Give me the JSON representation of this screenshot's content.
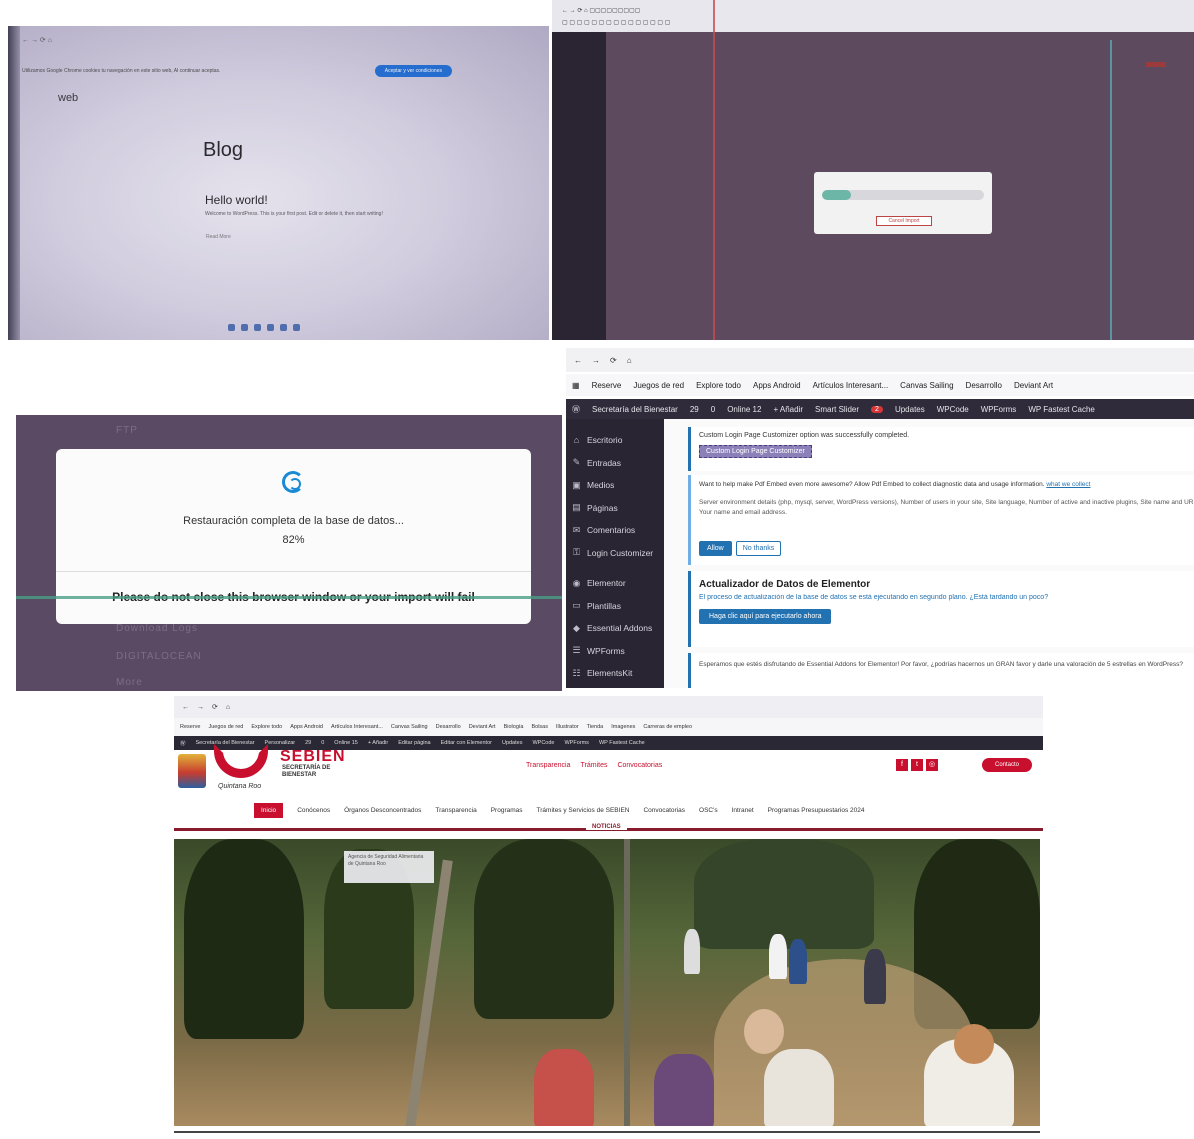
{
  "panel1": {
    "cookie_text": "Utilizamos Google Chrome cookies tu navegación en este sitio web, Al continuar aceptas.",
    "cookie_button": "Aceptar y ver condiciones",
    "site_name": "web",
    "blog_title": "Blog",
    "post_title": "Hello world!",
    "post_excerpt": "Welcome to WordPress. This is your first post. Edit or delete it, then start writing!",
    "post_link": "Read More"
  },
  "panel2": {
    "progress_fraction": 0.18,
    "modal_button": "Cancel Import"
  },
  "panel3": {
    "modal_title": "Restauración completa de la base de datos...",
    "modal_percent": "82%",
    "modal_warning": "Please do not close this browser window or your import will fail",
    "background_rows": [
      "FTP",
      "Download Logs",
      "DIGITALOCEAN",
      "More"
    ]
  },
  "panel4": {
    "bookmarks": [
      "Reserve",
      "Juegos de red",
      "Explore todo",
      "Apps Android",
      "Artículos Interesant...",
      "Canvas Sailing",
      "Desarrollo",
      "Deviant Art"
    ],
    "adminbar": [
      "Secretaría del Bienestar",
      "29",
      "0",
      "Online 12",
      "+ Añadir",
      "Smart Slider",
      "Updates",
      "WPCode",
      "WPForms",
      "WP Fastest Cache"
    ],
    "adminbar_badge": "2",
    "sidebar": [
      {
        "label": "Escritorio",
        "icon": "dashboard-icon",
        "glyph": "⌂"
      },
      {
        "label": "Entradas",
        "icon": "pin-icon",
        "glyph": "✎"
      },
      {
        "label": "Medios",
        "icon": "media-icon",
        "glyph": "▣"
      },
      {
        "label": "Páginas",
        "icon": "pages-icon",
        "glyph": "▤"
      },
      {
        "label": "Comentarios",
        "icon": "comment-icon",
        "glyph": "✉"
      },
      {
        "label": "Login Customizer",
        "icon": "lock-icon",
        "glyph": "⚿"
      },
      {
        "label": "Elementor",
        "icon": "elementor-icon",
        "glyph": "◉"
      },
      {
        "label": "Plantillas",
        "icon": "folder-icon",
        "glyph": "▭"
      },
      {
        "label": "Essential Addons",
        "icon": "addons-icon",
        "glyph": "◆"
      },
      {
        "label": "WPForms",
        "icon": "forms-icon",
        "glyph": "☰"
      },
      {
        "label": "ElementsKit",
        "icon": "kit-icon",
        "glyph": "☷"
      }
    ],
    "notice1_text": "Custom Login Page Customizer option was successfully completed.",
    "notice1_button": "Custom Login Page Customizer",
    "notice2_text": "Want to help make Pdf Embed even more awesome? Allow Pdf Embed to collect diagnostic data and usage information.",
    "notice2_link": "what we collect",
    "notice2_details": "Server environment details (php, mysql, server, WordPress versions), Number of users in your site, Site language, Number of active and inactive plugins, Site name and URL, Your name and email address.",
    "notice2_allow": "Allow",
    "notice2_deny": "No thanks",
    "notice3_title": "Actualizador de Datos de Elementor",
    "notice3_text": "El proceso de actualización de la base de datos se está ejecutando en segundo plano. ¿Está tardando un poco?",
    "notice3_button": "Haga clic aquí para ejecutarlo ahora",
    "notice4_text": "Esperamos que estés disfrutando de Essential Addons for Elementor! Por favor, ¿podrías hacernos un GRAN favor y darle una valoración de 5 estrellas en WordPress?"
  },
  "panel5": {
    "bookmarks": [
      "Reserve",
      "Juegos de red",
      "Explore todo",
      "Apps Android",
      "Artículos Interesant...",
      "Canvas Sailing",
      "Desarrollo",
      "Deviant Art",
      "Biología",
      "Bolsas",
      "Illustrator",
      "Tienda",
      "Imagenes",
      "Carreras de empleo"
    ],
    "adminbar": [
      "Secretaría del Bienestar",
      "Personalizar",
      "29",
      "0",
      "Online 15",
      "+ Añadir",
      "Editar página",
      "Editar con Elementor",
      "Updates",
      "WPCode",
      "WPForms",
      "WP Fastest Cache"
    ],
    "brand": "SEBIEN",
    "brand_sub": "SECRETARÍA DE BIENESTAR",
    "logo_sub": "Quintana Roo",
    "toplinks": [
      "Transparencia",
      "Trámites",
      "Convocatorias"
    ],
    "contact_button": "Contacto",
    "nav": [
      "Inicio",
      "Conócenos",
      "Órganos Desconcentrados",
      "Transparencia",
      "Programas",
      "Trámites y Servicios de SEBIEN",
      "Convocatorias",
      "OSC's",
      "Intranet",
      "Programas Presupuestarios 2024"
    ],
    "news_label": "NOTICIAS",
    "dropdown_text": "Agencia de Seguridad Alimentaria de Quintana Roo"
  }
}
